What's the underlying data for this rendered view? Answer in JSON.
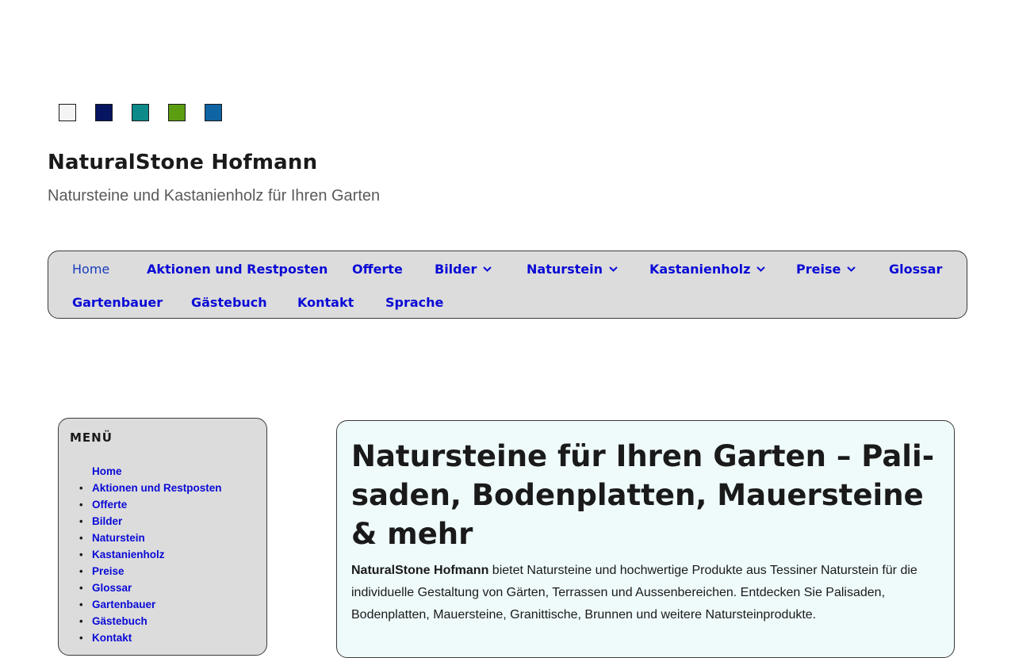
{
  "color_swatches": [
    {
      "name": "white",
      "color": "#f4f4f4"
    },
    {
      "name": "navy",
      "color": "#061560"
    },
    {
      "name": "teal",
      "color": "#0e8a8a"
    },
    {
      "name": "green",
      "color": "#5c9e12"
    },
    {
      "name": "blue",
      "color": "#0f64a3"
    }
  ],
  "header": {
    "site_title": "NaturalStone Hofmann",
    "tagline": "Natursteine und Kastanienholz für Ihren Garten"
  },
  "main_nav": {
    "items": [
      {
        "label": "Home",
        "current": true
      },
      {
        "label": "Aktionen und Restposten"
      },
      {
        "label": "Offerte"
      },
      {
        "label": "Bilder",
        "dropdown": true
      },
      {
        "label": "Naturstein",
        "dropdown": true
      },
      {
        "label": "Kastanienholz",
        "dropdown": true
      },
      {
        "label": "Preise",
        "dropdown": true
      },
      {
        "label": "Glossar"
      },
      {
        "label": "Gartenbauer"
      },
      {
        "label": "Gästebuch"
      },
      {
        "label": "Kontakt"
      },
      {
        "label": "Sprache"
      }
    ],
    "chevron": "⌄"
  },
  "sidebar": {
    "title": "MENÜ",
    "items": [
      "Home",
      "Aktionen und Restposten",
      "Offerte",
      "Bilder",
      "Naturstein",
      "Kastanienholz",
      "Preise",
      "Glossar",
      "Gartenbauer",
      "Gästebuch",
      "Kontakt"
    ],
    "bullet": "•"
  },
  "content": {
    "heading": "Natursteine für Ihren Garten – Pali­saden, Bodenplatten, Mauersteine & mehr",
    "intro_strong": "NaturalStone Hofmann",
    "intro_text": " bietet Natursteine und hochwertige Produkte aus Tessiner Naturstein für die individuelle Gestaltung von Gärten, Terrassen und Aussenbereichen. Entdecken Sie Palisaden, Bodenplatten, Mauersteine, Granittische, Brunnen und weitere Natursteinprodukte."
  }
}
